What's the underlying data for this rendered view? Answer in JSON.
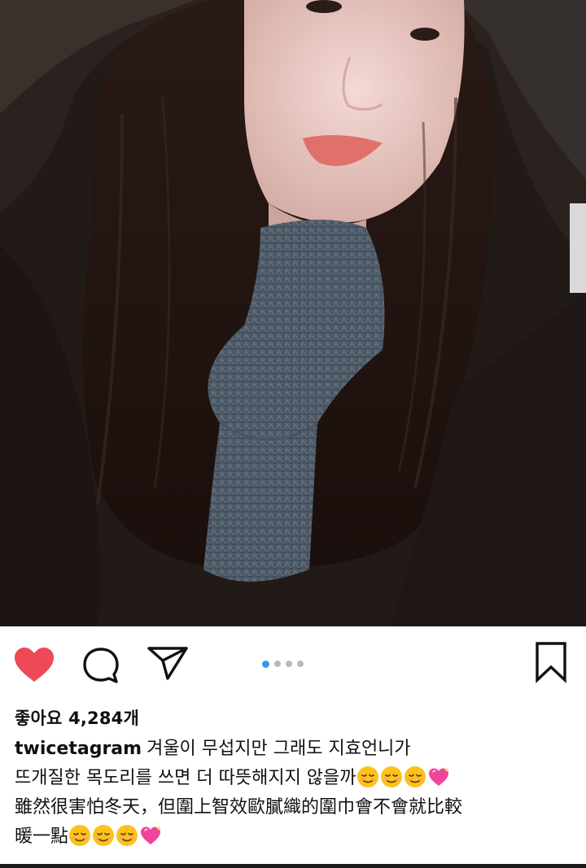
{
  "post": {
    "likes_text": "좋아요 4,284개",
    "username": "twicetagram",
    "caption_line1": "겨울이 무섭지만 그래도 지효언니가",
    "caption_line2": "뜨개질한 목도리를 쓰면 더 따뜻해지지 않을까",
    "caption_line3": "雖然很害怕冬天，但圍上智效歐膩織的圍巾會不會就比較",
    "caption_line4": "暖一點"
  },
  "icons": {
    "like": "heart-filled-icon",
    "comment": "speech-bubble-icon",
    "share": "paper-plane-icon",
    "save": "bookmark-icon",
    "emoji_smile": "relieved-face-emoji",
    "emoji_heart": "sparkling-heart-emoji"
  },
  "carousel": {
    "total": 4,
    "active_index": 0
  },
  "colors": {
    "like_red": "#ed4956",
    "carousel_active": "#3897f0",
    "carousel_inactive": "#b9b9b9",
    "text": "#111111"
  }
}
